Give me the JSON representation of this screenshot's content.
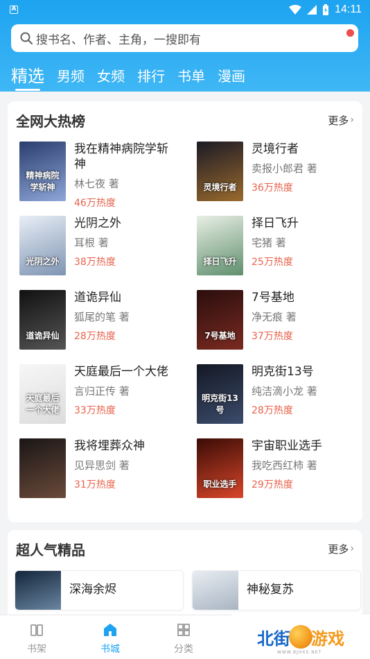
{
  "status": {
    "time": "14:11"
  },
  "search": {
    "placeholder": "搜书名、作者、主角，一搜即有"
  },
  "tabs": [
    "精选",
    "男频",
    "女频",
    "排行",
    "书单",
    "漫画"
  ],
  "hot": {
    "title": "全网大热榜",
    "more": "更多",
    "books": [
      {
        "title": "我在精神病院学斩神",
        "author": "林七夜 著",
        "heat": "46万热度",
        "cover_text": "精神病院学斩神",
        "c1": "#2a3e6e",
        "c2": "#8ea6d8"
      },
      {
        "title": "灵境行者",
        "author": "卖报小郎君 著",
        "heat": "36万热度",
        "cover_text": "灵境行者",
        "c1": "#1b1a26",
        "c2": "#9a6a2c"
      },
      {
        "title": "光阴之外",
        "author": "耳根 著",
        "heat": "38万热度",
        "cover_text": "光阴之外",
        "c1": "#e8eef6",
        "c2": "#7e94b2"
      },
      {
        "title": "择日飞升",
        "author": "宅猪 著",
        "heat": "25万热度",
        "cover_text": "择日飞升",
        "c1": "#e9efe5",
        "c2": "#5f8f6d"
      },
      {
        "title": "道诡异仙",
        "author": "狐尾的笔 著",
        "heat": "28万热度",
        "cover_text": "道诡异仙",
        "c1": "#111",
        "c2": "#555"
      },
      {
        "title": "7号基地",
        "author": "净无痕 著",
        "heat": "37万热度",
        "cover_text": "7号基地",
        "c1": "#2a0e0e",
        "c2": "#7a2a20"
      },
      {
        "title": "天庭最后一个大佬",
        "author": "言归正传 著",
        "heat": "33万热度",
        "cover_text": "天庭最后一个大佬",
        "c1": "#f7f7f7",
        "c2": "#dcdcdc"
      },
      {
        "title": "明克街13号",
        "author": "纯洁滴小龙 著",
        "heat": "28万热度",
        "cover_text": "明克街13号",
        "c1": "#141824",
        "c2": "#3c4c6c"
      },
      {
        "title": "我将埋葬众神",
        "author": "见异思剑 著",
        "heat": "31万热度",
        "cover_text": "",
        "c1": "#1a1616",
        "c2": "#6a4a3a"
      },
      {
        "title": "宇宙职业选手",
        "author": "我吃西红柿 著",
        "heat": "29万热度",
        "cover_text": "职业选手",
        "c1": "#3a0c06",
        "c2": "#d8462a"
      }
    ]
  },
  "popular": {
    "title": "超人气精品",
    "more": "更多",
    "books": [
      {
        "title": "深海余烬",
        "c1": "#13263a",
        "c2": "#6e8aa6"
      },
      {
        "title": "神秘复苏",
        "c1": "#e8edf2",
        "c2": "#a6b2c0"
      }
    ]
  },
  "nav": {
    "items": [
      {
        "label": "书架",
        "icon": "bookshelf-icon"
      },
      {
        "label": "书城",
        "icon": "home-icon"
      },
      {
        "label": "分类",
        "icon": "category-icon"
      }
    ]
  },
  "brand": {
    "text1": "北街",
    "text2": "游戏",
    "sub": "WWW.BJHXS.NET"
  },
  "colors": {
    "primary": "#1da3f0",
    "heat": "#e8614b"
  }
}
